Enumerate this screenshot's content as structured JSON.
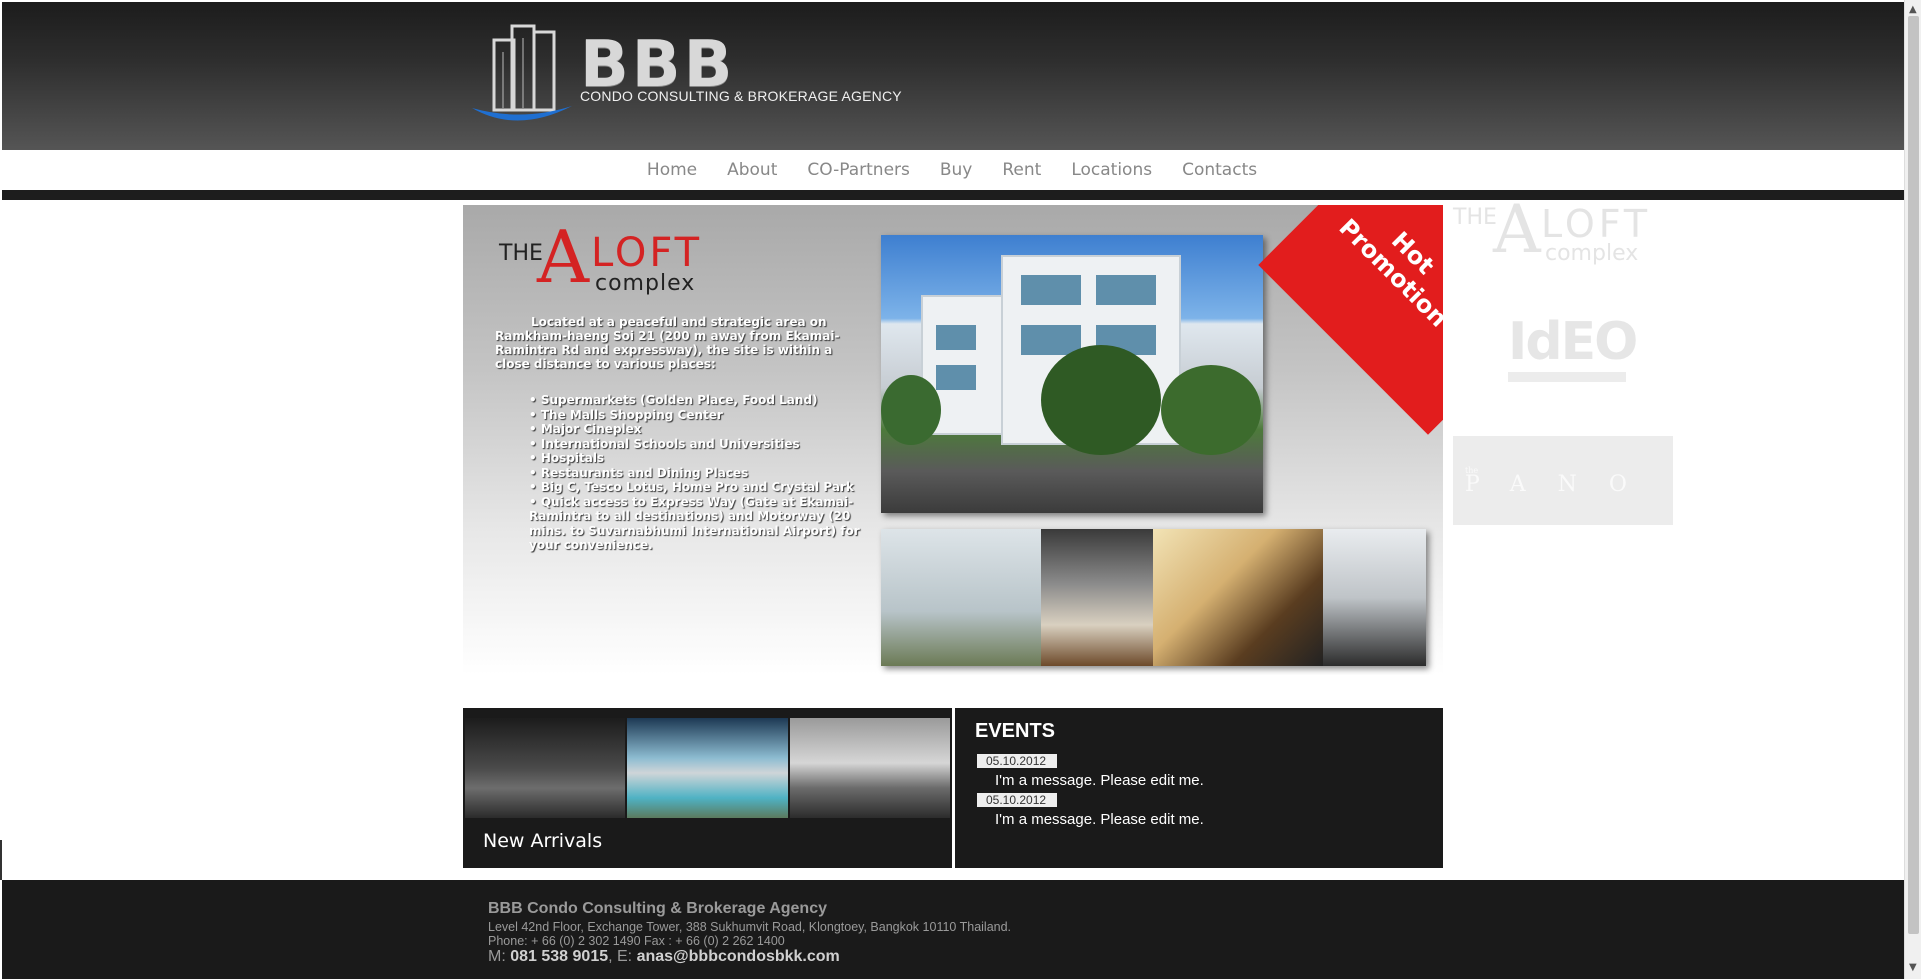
{
  "header": {
    "brand": "BBB",
    "tagline": "CONDO CONSULTING & BROKERAGE AGENCY"
  },
  "nav": {
    "items": [
      {
        "label": "Home"
      },
      {
        "label": "About"
      },
      {
        "label": "CO-Partners"
      },
      {
        "label": "Buy"
      },
      {
        "label": "Rent"
      },
      {
        "label": "Locations"
      },
      {
        "label": "Contacts"
      }
    ]
  },
  "promo": {
    "logo": {
      "the": "THE",
      "a": "A",
      "loft": "LOFT",
      "complex": "complex"
    },
    "badge": "Hot Promotion",
    "intro": "Located at a peaceful and strategic area on Ramkham-haeng Soi 21 (200 m away from Ekamai-Ramintra Rd and expressway), the site is within a close distance to various places:",
    "list": [
      "• Supermarkets (Golden Place, Food Land)",
      "• The Malls Shopping Center",
      "• Major Cineplex",
      "• International Schools and Universities",
      "• Hospitals",
      "• Restaurants and Dining Places",
      "• Big C, Tesco Lotus, Home Pro and Crystal Park",
      "• Quick access to Express Way (Gate at Ekamai-Ramintra to all destinations) and Motorway (20 mins. to Suvarnabhumi International Airport) for your convenience."
    ],
    "colors": {
      "brand_red": "#d42323",
      "badge_red": "#e21d1d"
    }
  },
  "side_logos": {
    "aloft": {
      "the": "THE",
      "a": "A",
      "loft": "LOFT",
      "complex": "complex"
    },
    "ideo": {
      "glyphs": "IdEO"
    },
    "pano": {
      "the": "the",
      "name": "PANO"
    }
  },
  "arrivals": {
    "label": "New Arrivals"
  },
  "events": {
    "title": "EVENTS",
    "items": [
      {
        "date": "05.10.2012",
        "message": "I'm a message. Please edit me."
      },
      {
        "date": "05.10.2012",
        "message": "I'm a message. Please edit me."
      }
    ]
  },
  "footer": {
    "name": "BBB Condo Consulting & Brokerage Agency",
    "address": "Level 42nd Floor, Exchange Tower, 388 Sukhumvit Road, Klongtoey, Bangkok 10110 Thailand.",
    "phone": "Phone: + 66 (0) 2 302 1490   Fax : + 66 (0) 2 262 1400",
    "mobile_prefix": "M:",
    "mobile": "081 538 9015",
    "email_prefix": ", E:",
    "email": "anas@bbbcondosbkk.com"
  }
}
